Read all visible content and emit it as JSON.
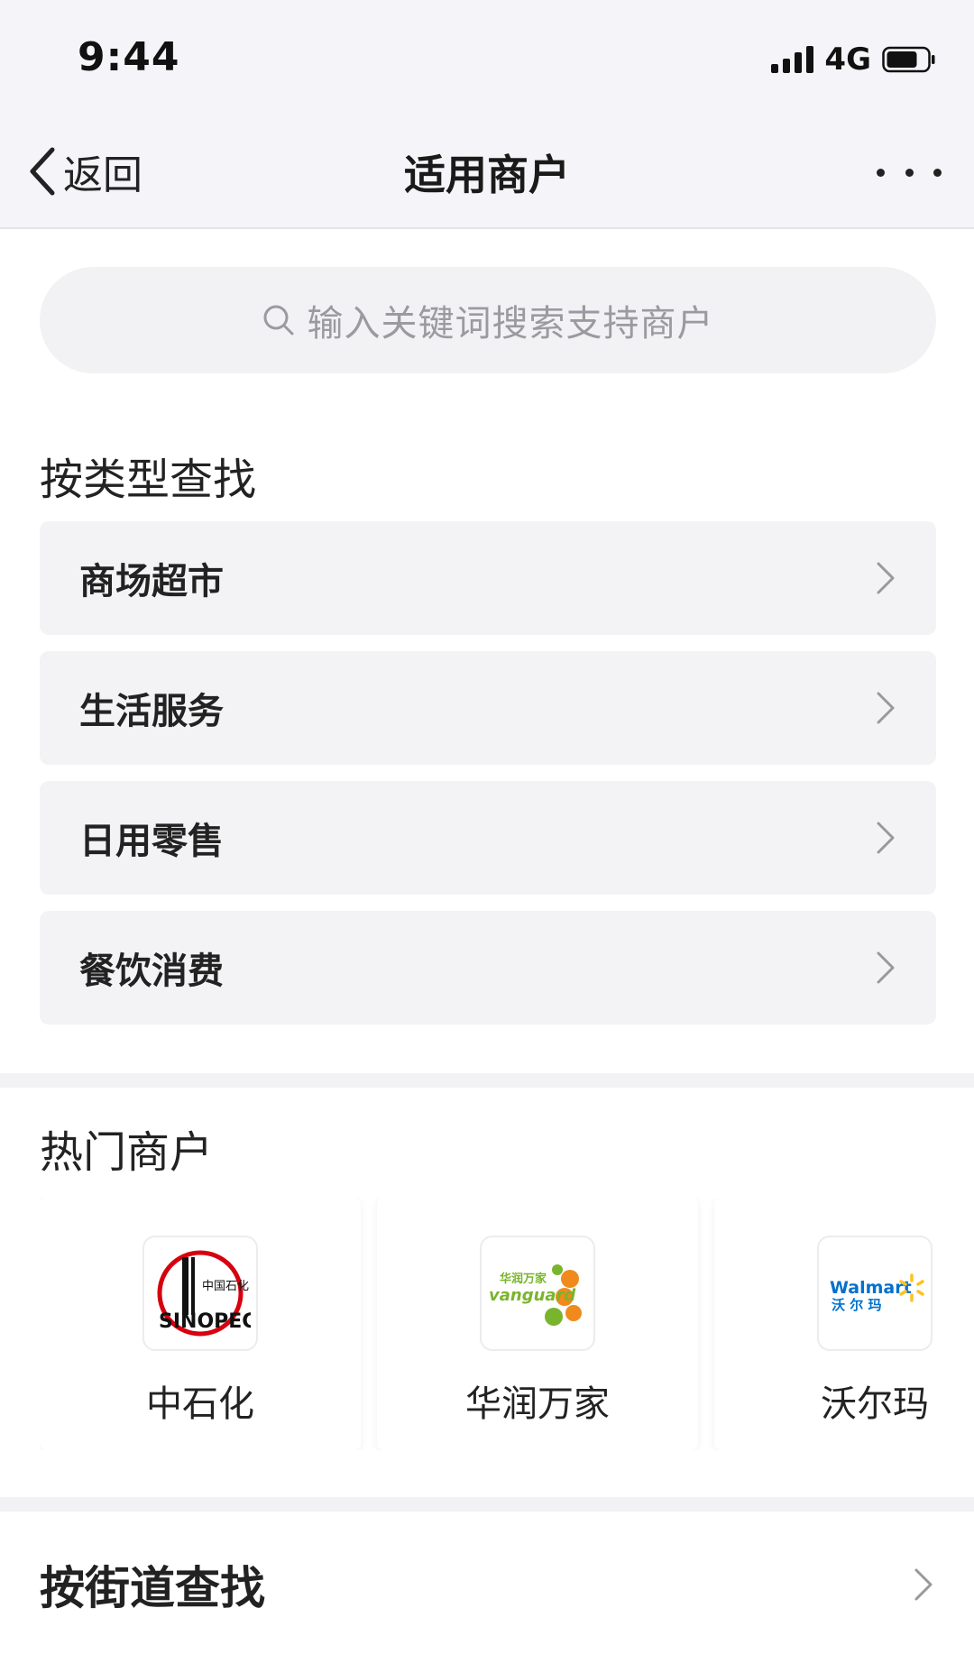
{
  "status_bar": {
    "time": "9:44",
    "network": "4G",
    "icons": [
      "signal-icon",
      "battery-icon"
    ]
  },
  "nav": {
    "back_label": "返回",
    "title": "适用商户",
    "icons": [
      "chevron-left-icon",
      "more-icon"
    ]
  },
  "search": {
    "placeholder": "输入关键词搜索支持商户",
    "icon": "search-icon"
  },
  "category_section": {
    "heading": "按类型查找",
    "items": [
      {
        "label": "商场超市"
      },
      {
        "label": "生活服务"
      },
      {
        "label": "日用零售"
      },
      {
        "label": "餐饮消费"
      }
    ]
  },
  "hot_section": {
    "heading": "热门商户",
    "merchants": [
      {
        "name": "中石化",
        "logo": {
          "icon": "sinopec-logo",
          "text": "SINOPEC",
          "cn_text": "中国石化",
          "color": "#d7000f"
        }
      },
      {
        "name": "华润万家",
        "logo": {
          "icon": "vanguard-logo",
          "text": "vanguard",
          "cn_text": "华润万家",
          "color": "#79b52c",
          "accent": "#f08a1c"
        }
      },
      {
        "name": "沃尔玛",
        "logo": {
          "icon": "walmart-logo",
          "text": "Walmart",
          "cn_text": "沃 尔 玛",
          "color": "#0071ce",
          "accent": "#ffc220"
        }
      }
    ]
  },
  "street_section": {
    "label": "按街道查找"
  },
  "colors": {
    "nav_background": "#f5f4f8",
    "card_background": "#f3f3f5",
    "placeholder_text": "#9a9aa0"
  }
}
